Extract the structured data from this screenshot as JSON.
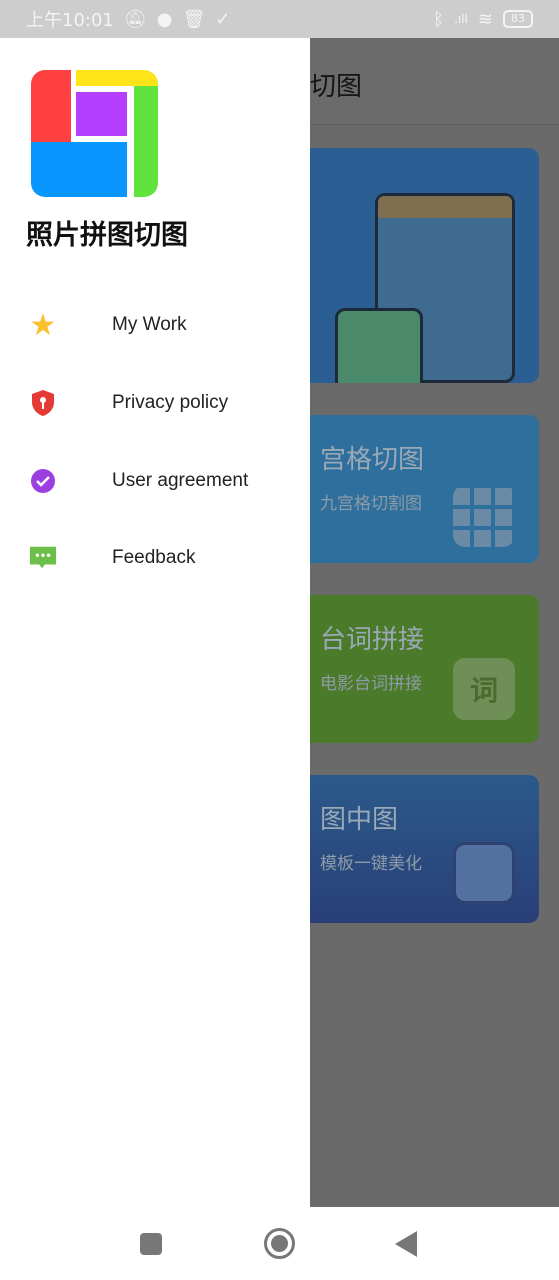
{
  "status_bar": {
    "time": "上午10:01",
    "battery": "83",
    "icons": [
      "mute-icon",
      "chat-icon",
      "trash-icon",
      "download-done-icon",
      "bluetooth-icon",
      "signal-icon",
      "wifi-icon",
      "battery-icon"
    ]
  },
  "background_app": {
    "header_title": "切图",
    "cards": [
      {
        "title": "",
        "subtitle": "",
        "color": "#2b5f93"
      },
      {
        "title": "宫格切图",
        "subtitle": "九宫格切割图",
        "icon": "grid-icon",
        "color": "#2f6f9e"
      },
      {
        "title": "台词拼接",
        "subtitle": "电影台词拼接",
        "icon_text": "词",
        "color": "#4b7a2a"
      },
      {
        "title": "图中图",
        "subtitle": "模板一键美化",
        "icon": "picture-frame-icon",
        "color": "#2a4a80"
      }
    ]
  },
  "drawer": {
    "app_name": "照片拼图切图",
    "items": [
      {
        "label": "My Work",
        "icon": "star-icon",
        "color": "#fbc02d"
      },
      {
        "label": "Privacy policy",
        "icon": "shield-icon",
        "color": "#e53935"
      },
      {
        "label": "User agreement",
        "icon": "check-circle-icon",
        "color": "#9c3fe0"
      },
      {
        "label": "Feedback",
        "icon": "message-icon",
        "color": "#6cc04a"
      }
    ]
  },
  "nav_bar": {
    "buttons": [
      "recents",
      "home",
      "back"
    ]
  }
}
